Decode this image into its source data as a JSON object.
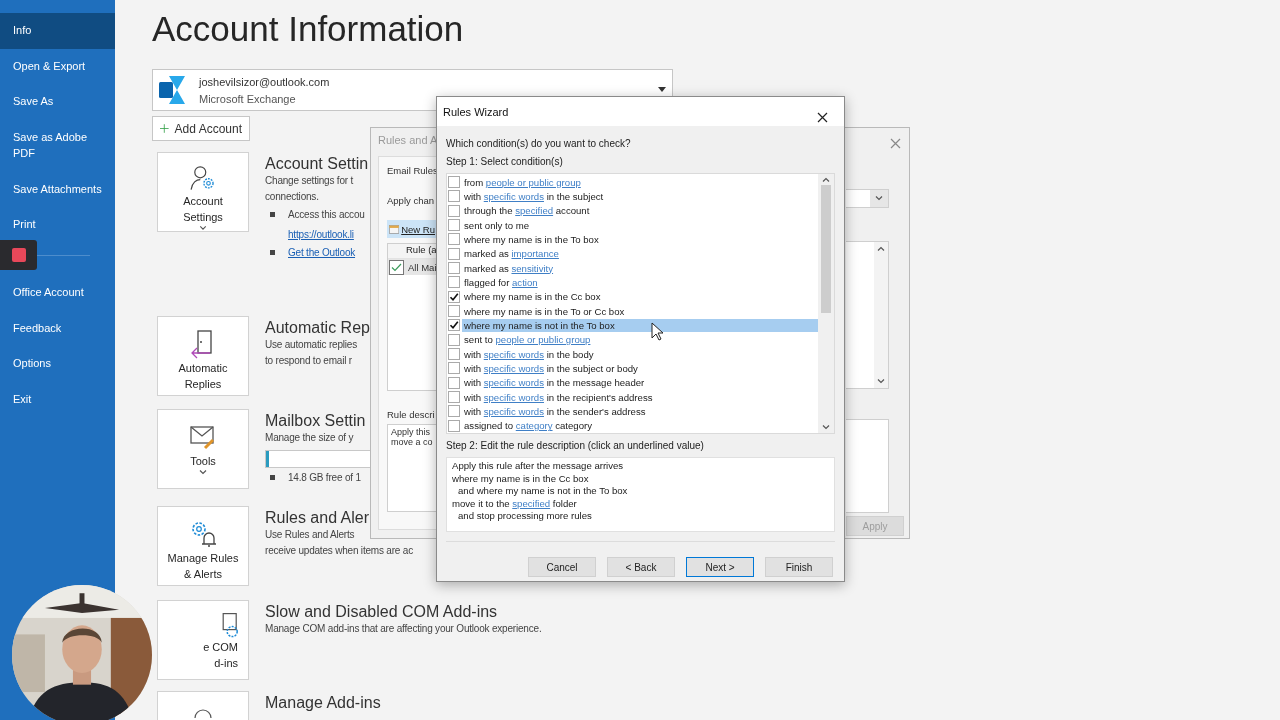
{
  "sidebar": {
    "items": [
      {
        "label": "Info",
        "selected": true
      },
      {
        "label": "Open & Export",
        "selected": false
      },
      {
        "label": "Save As",
        "selected": false
      },
      {
        "label": "Save as Adobe PDF",
        "selected": false
      },
      {
        "label": "Save Attachments",
        "selected": false
      },
      {
        "label": "Print",
        "selected": false
      },
      {
        "label": "Office Account",
        "selected": false
      },
      {
        "label": "Feedback",
        "selected": false
      },
      {
        "label": "Options",
        "selected": false
      },
      {
        "label": "Exit",
        "selected": false
      }
    ]
  },
  "page": {
    "title": "Account Information"
  },
  "account": {
    "email": "joshevilsizor@outlook.com",
    "type": "Microsoft Exchange"
  },
  "add_account": "Add Account",
  "sections": [
    {
      "kind": "account",
      "tile": [
        "Account",
        "Settings"
      ],
      "heading": "Account Settin",
      "lines": [
        "Change settings for t",
        "connections."
      ],
      "bullets": [
        {
          "text": "Access this accou",
          "link": "https://outlook.li"
        },
        {
          "link": "Get the Outlook"
        }
      ]
    },
    {
      "kind": "autoreply",
      "tile": [
        "Automatic",
        "Replies"
      ],
      "heading": "Automatic Rep",
      "lines": [
        "Use automatic replies",
        "to respond to email r"
      ]
    },
    {
      "kind": "mailbox",
      "tile": [
        "Tools"
      ],
      "heading": "Mailbox Settin",
      "lines": [
        "Manage the size of y"
      ],
      "meter": {
        "level": 0.03
      },
      "bullets": [
        {
          "text": "14.8 GB free of 1"
        }
      ]
    },
    {
      "kind": "rules",
      "tile": [
        "Manage Rules",
        "& Alerts"
      ],
      "heading": "Rules and Aler",
      "lines": [
        "Use Rules and Alerts",
        "receive updates when items are ac"
      ]
    },
    {
      "kind": "com",
      "tile": [
        "e COM",
        "d-ins"
      ],
      "heading": "Slow and Disabled COM Add-ins",
      "lines": [
        "Manage COM add-ins that are affecting your Outlook experience."
      ]
    },
    {
      "kind": "addins",
      "heading": "Manage Add-ins"
    }
  ],
  "rules_dialog": {
    "title": "Rules and A",
    "tab": "Email Rules",
    "apply_label": "Apply chan",
    "new_rule": "New Ru",
    "column": "Rule (a",
    "rows": [
      {
        "name": "All Mai",
        "checked": true
      }
    ],
    "description_label": "Rule descri",
    "description": [
      "Apply this",
      "move a co"
    ],
    "apply_button": {
      "label": "Apply",
      "disabled": true
    }
  },
  "wizard": {
    "title": "Rules Wizard",
    "question": "Which condition(s) do you want to check?",
    "step1": "Step 1: Select condition(s)",
    "conditions": [
      {
        "before": "from ",
        "link": "people or public group",
        "checked": false,
        "selected": false
      },
      {
        "before": "with ",
        "link": "specific words",
        "after": " in the subject",
        "checked": false,
        "selected": false
      },
      {
        "before": "through the ",
        "link": "specified",
        "after": " account",
        "checked": false,
        "selected": false
      },
      {
        "before": "sent only to me",
        "checked": false,
        "selected": false
      },
      {
        "before": "where my name is in the To box",
        "checked": false,
        "selected": false
      },
      {
        "before": "marked as ",
        "link": "importance",
        "checked": false,
        "selected": false
      },
      {
        "before": "marked as ",
        "link": "sensitivity",
        "checked": false,
        "selected": false
      },
      {
        "before": "flagged for ",
        "link": "action",
        "checked": false,
        "selected": false
      },
      {
        "before": "where my name is in the Cc box",
        "checked": true,
        "selected": false
      },
      {
        "before": "where my name is in the To or Cc box",
        "checked": false,
        "selected": false
      },
      {
        "before": "where my name is not in the To box",
        "checked": true,
        "selected": true
      },
      {
        "before": "sent to ",
        "link": "people or public group",
        "checked": false,
        "selected": false
      },
      {
        "before": "with ",
        "link": "specific words",
        "after": " in the body",
        "checked": false,
        "selected": false
      },
      {
        "before": "with ",
        "link": "specific words",
        "after": " in the subject or body",
        "checked": false,
        "selected": false
      },
      {
        "before": "with ",
        "link": "specific words",
        "after": " in the message header",
        "checked": false,
        "selected": false
      },
      {
        "before": "with ",
        "link": "specific words",
        "after": " in the recipient's address",
        "checked": false,
        "selected": false
      },
      {
        "before": "with ",
        "link": "specific words",
        "after": " in the sender's address",
        "checked": false,
        "selected": false
      },
      {
        "before": "assigned to ",
        "link": "category",
        "after": " category",
        "checked": false,
        "selected": false
      }
    ],
    "step2": "Step 2: Edit the rule description (click an underlined value)",
    "description": [
      {
        "before": "Apply this rule after the message arrives"
      },
      {
        "before": "where my name is in the Cc box",
        "children": [
          {
            "before": "and where my name is not in the To box"
          }
        ]
      },
      {
        "before": "move it to the ",
        "link": "specified",
        "after": " folder",
        "children": [
          {
            "before": "and stop processing more rules"
          }
        ]
      }
    ],
    "buttons": [
      {
        "label": "Cancel",
        "default": false
      },
      {
        "label": "< Back",
        "default": false
      },
      {
        "label": "Next >",
        "default": true
      },
      {
        "label": "Finish",
        "default": false
      }
    ]
  }
}
